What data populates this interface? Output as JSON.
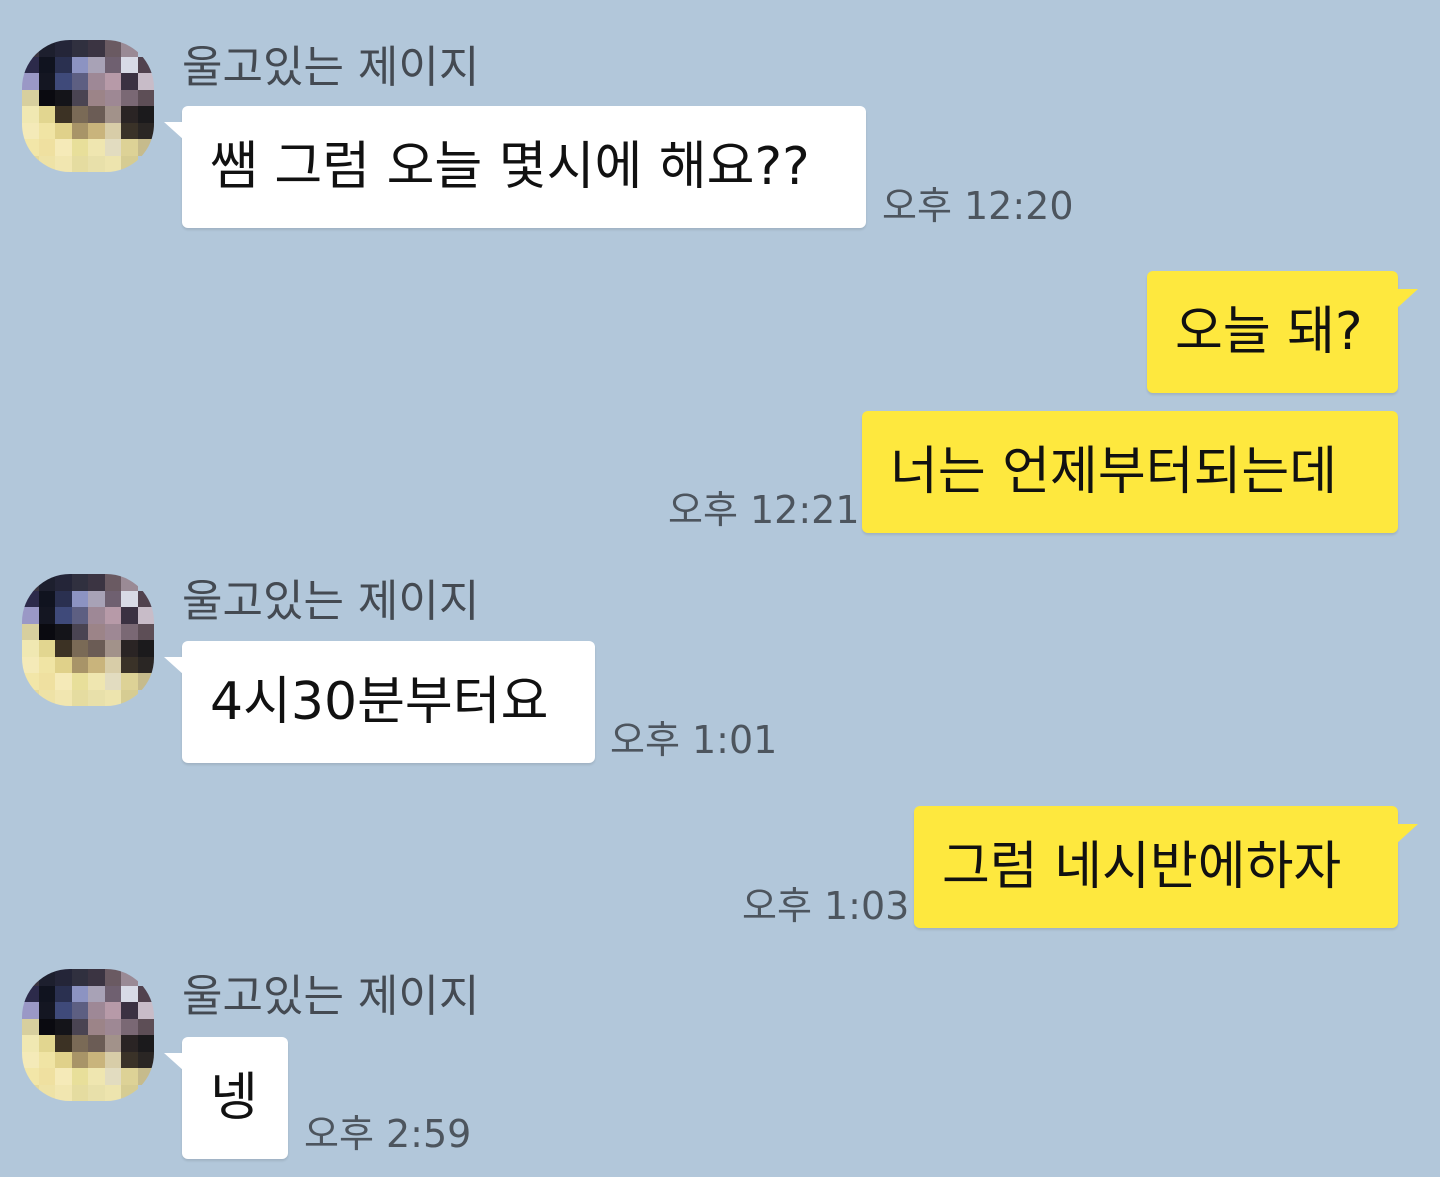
{
  "chat": {
    "messages": [
      {
        "sender": "울고있는 제이지",
        "text": "쌤 그럼 오늘 몇시에 해요??",
        "time": "오후 12:20",
        "direction": "incoming"
      },
      {
        "text": "오늘 돼?",
        "direction": "outgoing"
      },
      {
        "text": "너는 언제부터되는데",
        "time": "오후 12:21",
        "direction": "outgoing"
      },
      {
        "sender": "울고있는 제이지",
        "text": "4시30분부터요",
        "time": "오후 1:01",
        "direction": "incoming"
      },
      {
        "text": "그럼 네시반에하자",
        "time": "오후 1:03",
        "direction": "outgoing"
      },
      {
        "sender": "울고있는 제이지",
        "text": "넹",
        "time": "오후 2:59",
        "direction": "incoming"
      }
    ]
  },
  "colors": {
    "background": "#b2c7da",
    "incoming_bubble": "#ffffff",
    "outgoing_bubble": "#fee83e"
  }
}
